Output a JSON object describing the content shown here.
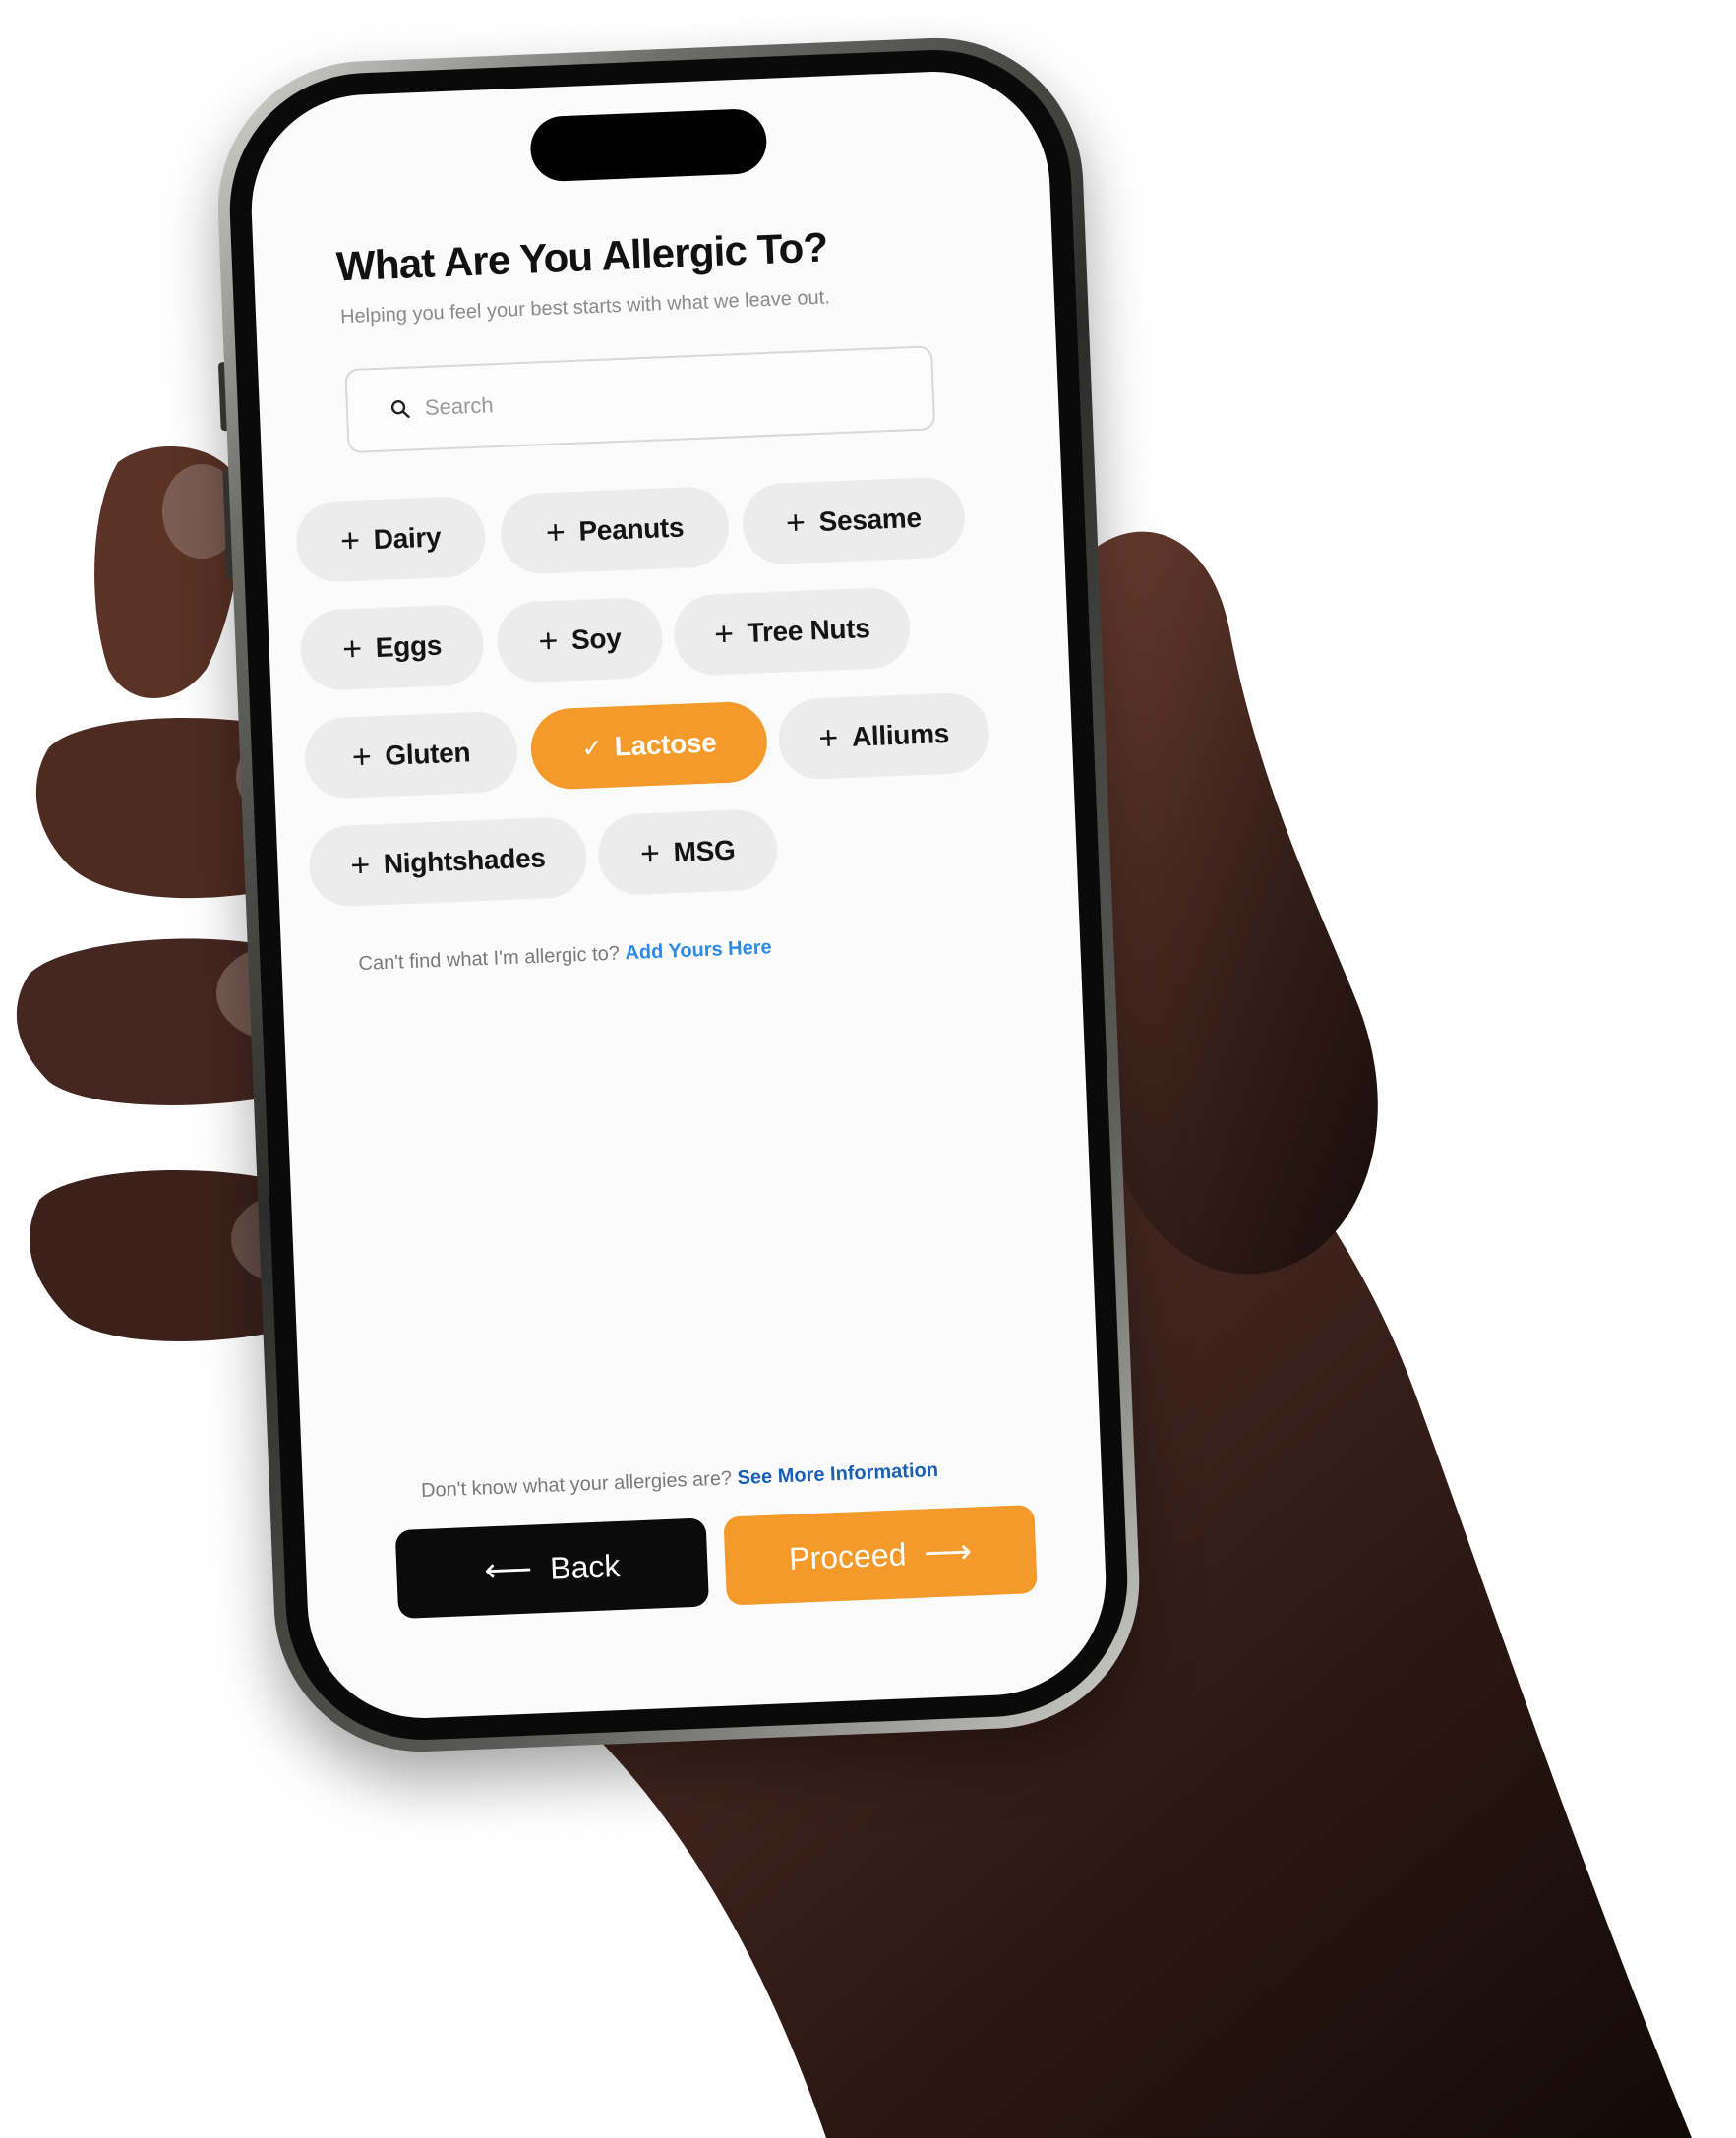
{
  "screen": {
    "title": "What Are You Allergic To?",
    "subtitle": "Helping you feel your best starts with what we leave out."
  },
  "search": {
    "placeholder": "Search",
    "value": ""
  },
  "allergens": [
    {
      "label": "Dairy",
      "selected": false
    },
    {
      "label": "Peanuts",
      "selected": false
    },
    {
      "label": "Sesame",
      "selected": false
    },
    {
      "label": "Eggs",
      "selected": false
    },
    {
      "label": "Soy",
      "selected": false
    },
    {
      "label": "Tree Nuts",
      "selected": false
    },
    {
      "label": "Gluten",
      "selected": false
    },
    {
      "label": "Lactose",
      "selected": true
    },
    {
      "label": "Alliums",
      "selected": false
    },
    {
      "label": "Nightshades",
      "selected": false
    },
    {
      "label": "MSG",
      "selected": false
    }
  ],
  "custom_hint": {
    "text": "Can't find what I'm allergic to?",
    "link": "Add Yours Here"
  },
  "info_hint": {
    "text": "Don't know what your allergies are?",
    "link": "See More Information"
  },
  "buttons": {
    "back_label": "Back",
    "proceed_label": "Proceed"
  },
  "icons": {
    "add": "plus-icon",
    "selected": "check-icon",
    "search": "search-icon",
    "back": "arrow-left-icon",
    "proceed": "arrow-right-icon"
  },
  "colors": {
    "accent": "#f39a2a",
    "chip_bg": "#ececec",
    "link": "#2e8ae8",
    "back_button": "#0b0b0b"
  }
}
